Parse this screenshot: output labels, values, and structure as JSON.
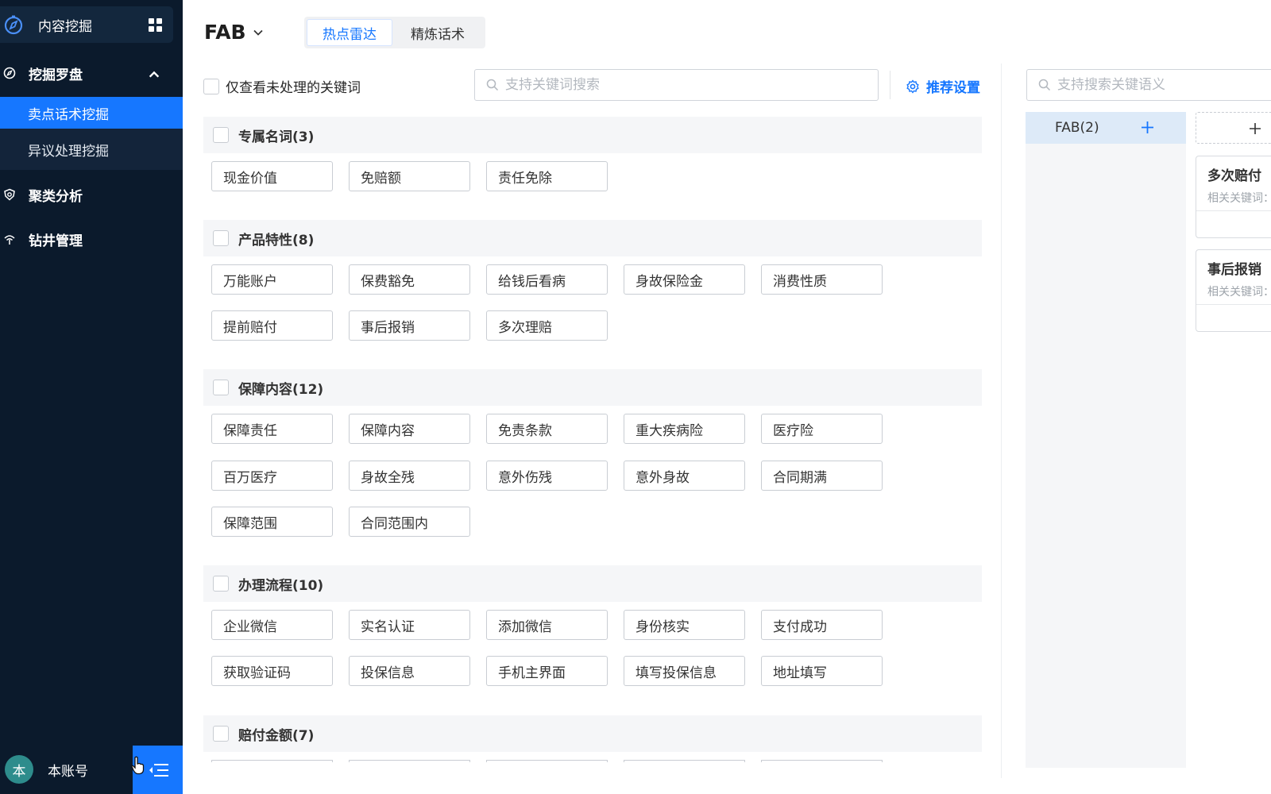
{
  "sidebar": {
    "app_title": "内容挖掘",
    "groups": [
      {
        "label": "挖掘罗盘"
      },
      {
        "label": "聚类分析"
      },
      {
        "label": "钻井管理"
      }
    ],
    "sub_items": [
      {
        "label": "卖点话术挖掘"
      },
      {
        "label": "异议处理挖掘"
      }
    ],
    "account": {
      "avatar": "本",
      "name": "本账号"
    }
  },
  "header": {
    "title": "FAB",
    "tabs": [
      {
        "label": "热点雷达"
      },
      {
        "label": "精炼话术"
      }
    ]
  },
  "filters": {
    "unprocessed_label": "仅查看未处理的关键词",
    "keyword_search_placeholder": "支持关键词搜索",
    "settings_label": "推荐设置"
  },
  "sections": [
    {
      "title": "专属名词(3)",
      "tags": [
        "现金价值",
        "免赔额",
        "责任免除"
      ]
    },
    {
      "title": "产品特性(8)",
      "tags": [
        "万能账户",
        "保费豁免",
        "给钱后看病",
        "身故保险金",
        "消费性质",
        "提前赔付",
        "事后报销",
        "多次理赔"
      ]
    },
    {
      "title": "保障内容(12)",
      "tags": [
        "保障责任",
        "保障内容",
        "免责条款",
        "重大疾病险",
        "医疗险",
        "百万医疗",
        "身故全残",
        "意外伤残",
        "意外身故",
        "合同期满",
        "保障范围",
        "合同范围内"
      ]
    },
    {
      "title": "办理流程(10)",
      "tags": [
        "企业微信",
        "实名认证",
        "添加微信",
        "身份核实",
        "支付成功",
        "获取验证码",
        "投保信息",
        "手机主界面",
        "填写投保信息",
        "地址填写"
      ]
    },
    {
      "title": "赔付金额(7)",
      "tags": []
    }
  ],
  "right_panel": {
    "semantic_search_placeholder": "支持搜索关键语义",
    "fab_item": "FAB(2)",
    "cards": [
      {
        "title": "多次赔付",
        "subtitle": "相关关键词："
      },
      {
        "title": "事后报销",
        "subtitle": "相关关键词："
      }
    ]
  },
  "colors": {
    "sidebar_bg": "#0b1a2c",
    "accent": "#1677ff",
    "section_bg": "#f5f6f8",
    "fab_item_bg": "#ddeaf8"
  }
}
